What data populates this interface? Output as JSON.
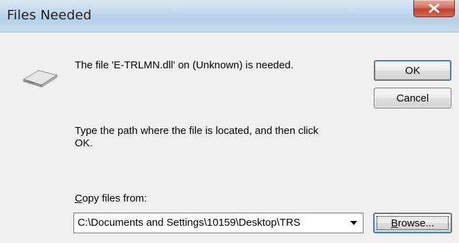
{
  "window": {
    "title": "Files Needed"
  },
  "message": {
    "line1": "The file 'E-TRLMN.dll' on (Unknown) is needed.",
    "line2a": "Type the path where the file is located, and then click",
    "line2b": "OK."
  },
  "copy_from": {
    "label_accel": "C",
    "label_rest": "opy files from:",
    "value": "C:\\Documents and Settings\\10159\\Desktop\\TRS"
  },
  "buttons": {
    "ok": "OK",
    "cancel": "Cancel",
    "browse_accel": "B",
    "browse_rest": "rowse..."
  },
  "icons": {
    "drive": "disk-drive-icon",
    "close": "close-icon",
    "dropdown": "chevron-down-icon"
  },
  "colors": {
    "close_button": "#c8503a",
    "dialog_background": "#f0f0f0",
    "title_bar": "#c5dbee"
  }
}
